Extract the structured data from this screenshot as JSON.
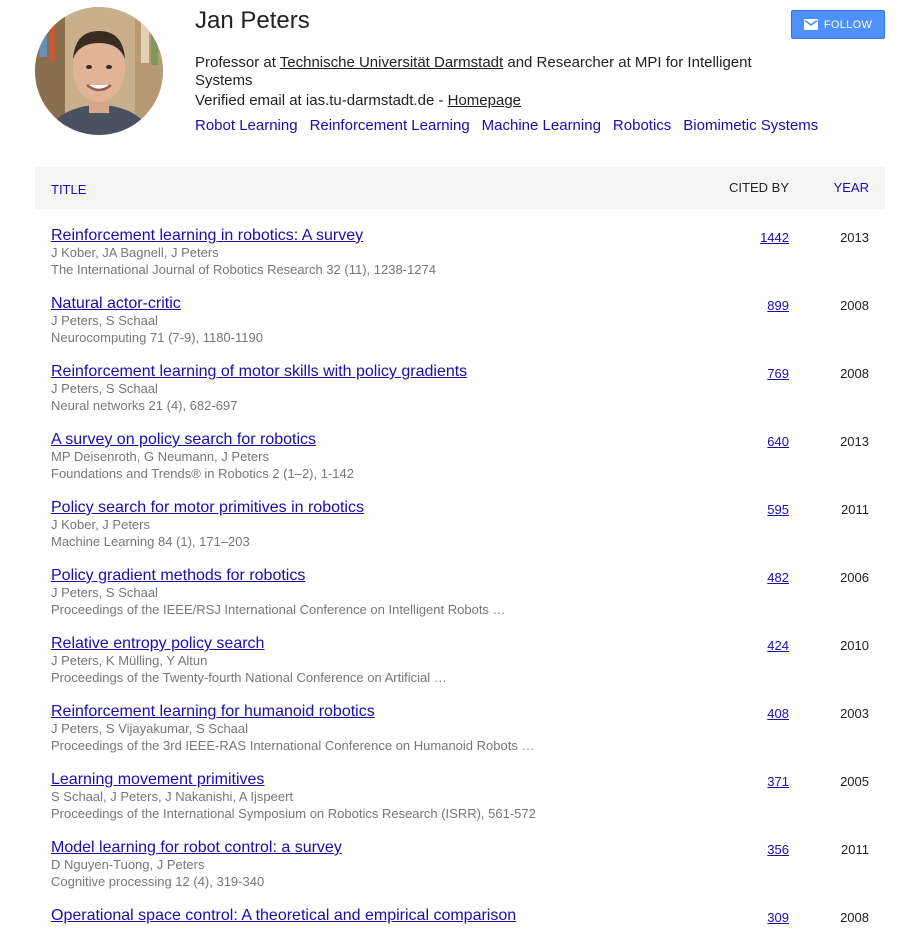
{
  "profile": {
    "name": "Jan Peters",
    "affiliation_prefix": "Professor at ",
    "affiliation_link": "Technische Universität Darmstadt",
    "affiliation_suffix": " and Researcher at MPI for Intelligent Systems",
    "email_text": "Verified email at ias.tu-darmstadt.de - ",
    "homepage_label": "Homepage",
    "interests": [
      "Robot Learning",
      "Reinforcement Learning",
      "Machine Learning",
      "Robotics",
      "Biomimetic Systems"
    ],
    "follow_label": "FOLLOW",
    "follow_icon": "envelope-icon"
  },
  "table": {
    "headers": {
      "title": "TITLE",
      "cited_by": "CITED BY",
      "year": "YEAR"
    },
    "rows": [
      {
        "title": "Reinforcement learning in robotics: A survey",
        "authors": "J Kober, JA Bagnell, J Peters",
        "venue": "The International Journal of Robotics Research 32 (11), 1238-1274",
        "cited_by": "1442",
        "year": "2013"
      },
      {
        "title": "Natural actor-critic",
        "authors": "J Peters, S Schaal",
        "venue": "Neurocomputing 71 (7-9), 1180-1190",
        "cited_by": "899",
        "year": "2008"
      },
      {
        "title": "Reinforcement learning of motor skills with policy gradients",
        "authors": "J Peters, S Schaal",
        "venue": "Neural networks 21 (4), 682-697",
        "cited_by": "769",
        "year": "2008"
      },
      {
        "title": "A survey on policy search for robotics",
        "authors": "MP Deisenroth, G Neumann, J Peters",
        "venue": "Foundations and Trends® in Robotics 2 (1–2), 1-142",
        "cited_by": "640",
        "year": "2013"
      },
      {
        "title": "Policy search for motor primitives in robotics",
        "authors": "J Kober, J Peters",
        "venue": "Machine Learning 84 (1), 171–203",
        "cited_by": "595",
        "year": "2011"
      },
      {
        "title": "Policy gradient methods for robotics",
        "authors": "J Peters, S Schaal",
        "venue": "Proceedings of the IEEE/RSJ International Conference on Intelligent Robots …",
        "cited_by": "482",
        "year": "2006"
      },
      {
        "title": "Relative entropy policy search",
        "authors": "J Peters, K Mülling, Y Altun",
        "venue": "Proceedings of the Twenty-fourth National Conference on Artificial …",
        "cited_by": "424",
        "year": "2010"
      },
      {
        "title": "Reinforcement learning for humanoid robotics",
        "authors": "J Peters, S Vijayakumar, S Schaal",
        "venue": "Proceedings of the 3rd IEEE-RAS International Conference on Humanoid Robots …",
        "cited_by": "408",
        "year": "2003"
      },
      {
        "title": "Learning movement primitives",
        "authors": "S Schaal, J Peters, J Nakanishi, A Ijspeert",
        "venue": "Proceedings of the International Symposium on Robotics Research (ISRR), 561-572",
        "cited_by": "371",
        "year": "2005"
      },
      {
        "title": "Model learning for robot control: a survey",
        "authors": "D Nguyen-Tuong, J Peters",
        "venue": "Cognitive processing 12 (4), 319-340",
        "cited_by": "356",
        "year": "2011"
      },
      {
        "title": "Operational space control: A theoretical and empirical comparison",
        "authors": "",
        "venue": "",
        "cited_by": "309",
        "year": "2008"
      }
    ]
  },
  "colors": {
    "link": "#1a0dab",
    "follow_bg": "#4d90fe",
    "header_bg": "#f5f5f5",
    "meta_text": "#777777"
  }
}
